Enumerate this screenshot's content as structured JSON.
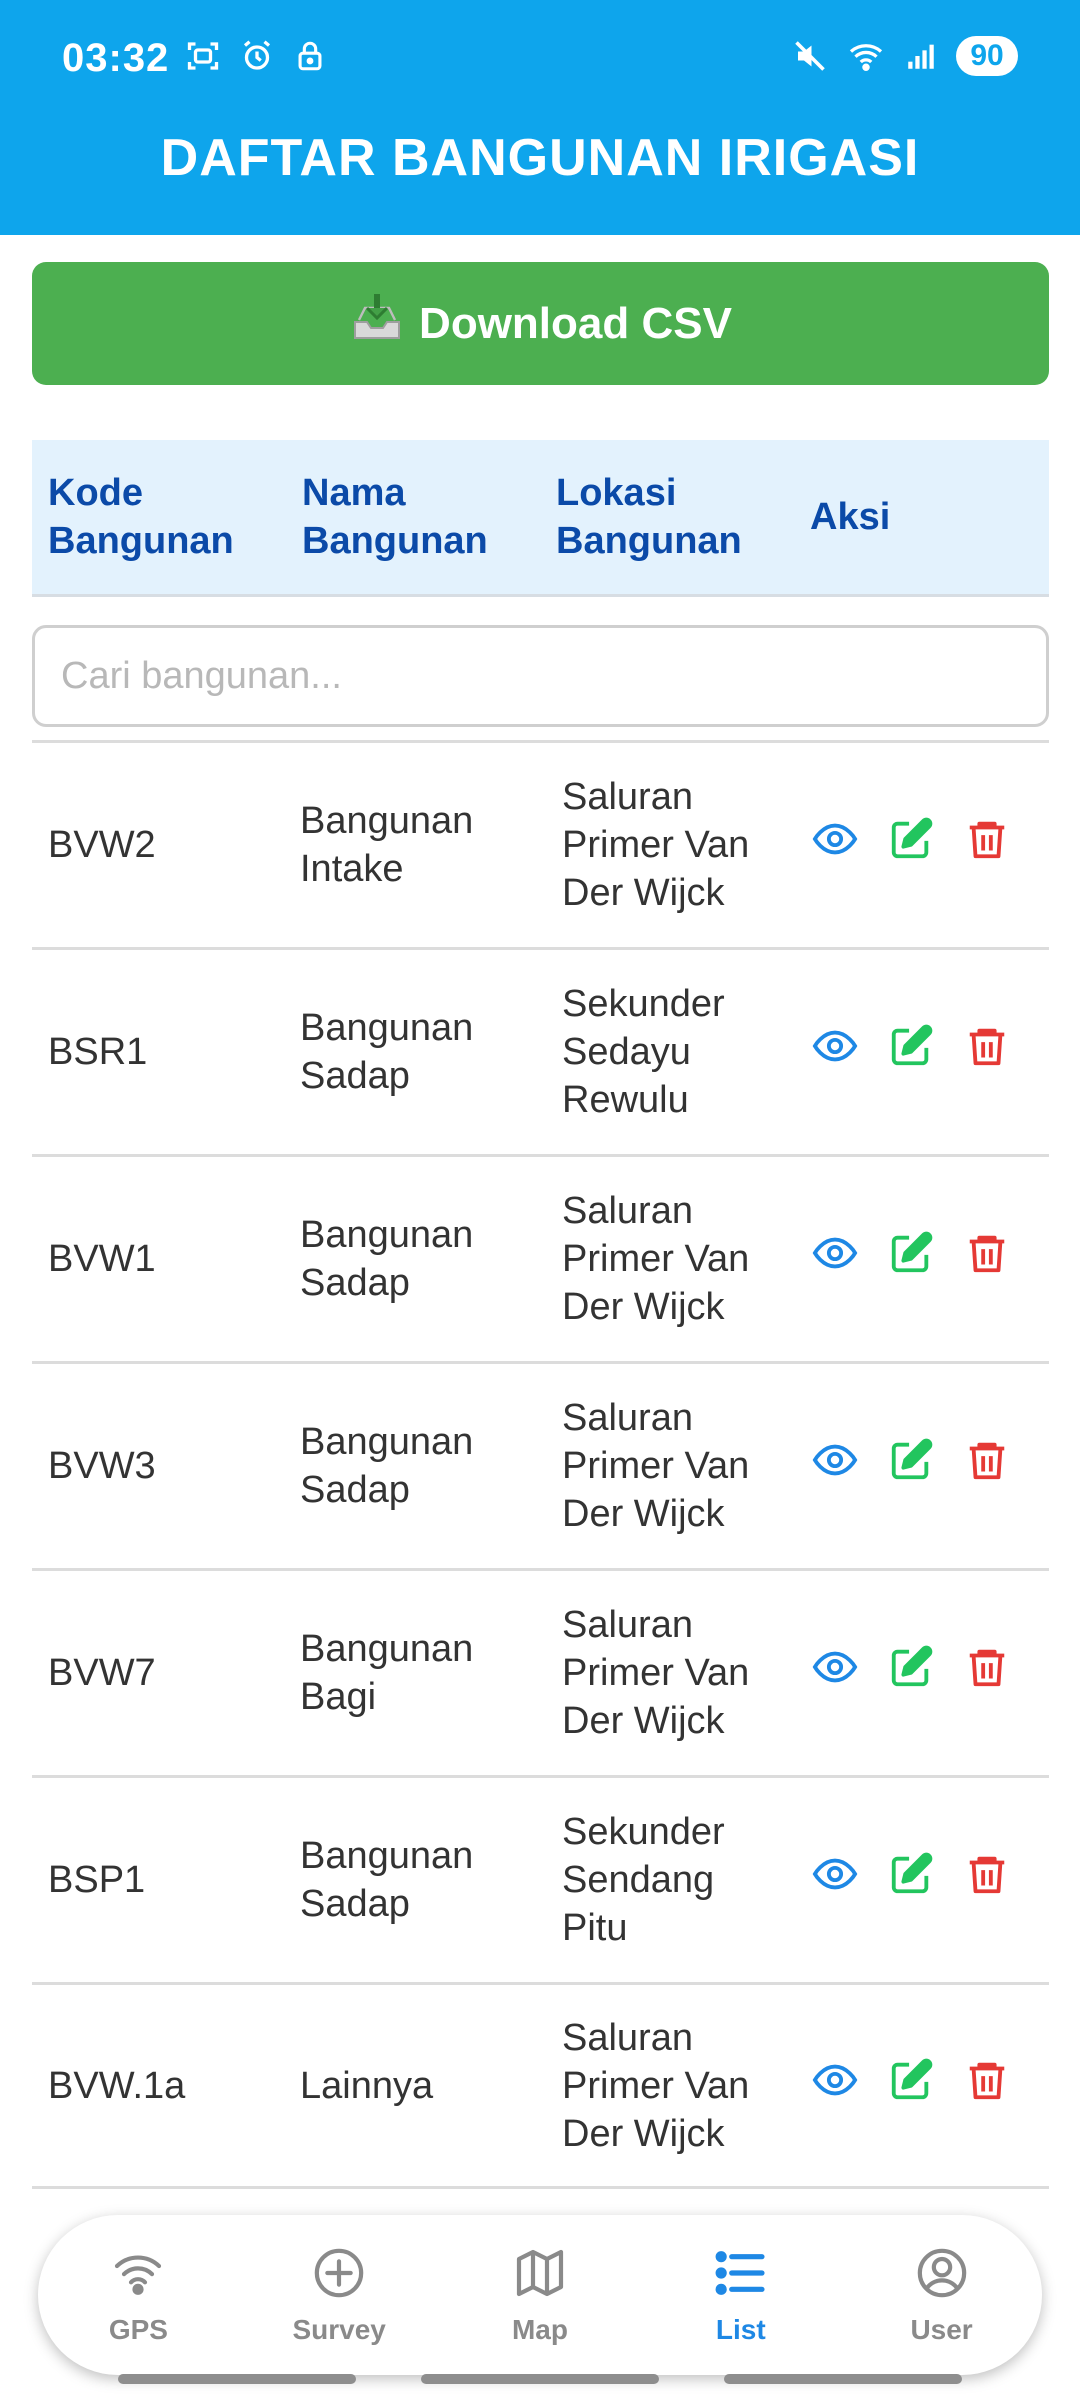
{
  "status_bar": {
    "time": "03:32",
    "battery": "90"
  },
  "header": {
    "title": "DAFTAR BANGUNAN IRIGASI"
  },
  "download_button": {
    "label": "Download CSV",
    "icon": "download-tray-icon"
  },
  "table": {
    "headers": [
      {
        "line1": "Kode",
        "line2": "Bangunan"
      },
      {
        "line1": "Nama",
        "line2": "Bangunan"
      },
      {
        "line1": "Lokasi",
        "line2": "Bangunan"
      },
      {
        "line1": "Aksi",
        "line2": ""
      }
    ],
    "rows": [
      {
        "kode": "BVW2",
        "nama": [
          "Bangunan",
          "Intake"
        ],
        "lokasi": [
          "Saluran",
          "Primer Van",
          "Der Wijck"
        ]
      },
      {
        "kode": "BSR1",
        "nama": [
          "Bangunan",
          "Sadap"
        ],
        "lokasi": [
          "Sekunder",
          "Sedayu",
          "Rewulu"
        ]
      },
      {
        "kode": "BVW1",
        "nama": [
          "Bangunan",
          "Sadap"
        ],
        "lokasi": [
          "Saluran",
          "Primer Van",
          "Der Wijck"
        ]
      },
      {
        "kode": "BVW3",
        "nama": [
          "Bangunan",
          "Sadap"
        ],
        "lokasi": [
          "Saluran",
          "Primer Van",
          "Der Wijck"
        ]
      },
      {
        "kode": "BVW7",
        "nama": [
          "Bangunan",
          "Bagi"
        ],
        "lokasi": [
          "Saluran",
          "Primer Van",
          "Der Wijck"
        ]
      },
      {
        "kode": "BSP1",
        "nama": [
          "Bangunan",
          "Sadap"
        ],
        "lokasi": [
          "Sekunder",
          "Sendang",
          "Pitu"
        ]
      },
      {
        "kode": "BVW.1a",
        "nama": [
          "Lainnya"
        ],
        "lokasi": [
          "Saluran",
          "Primer Van",
          "Der Wijck"
        ]
      }
    ]
  },
  "search": {
    "placeholder": "Cari bangunan..."
  },
  "colors": {
    "header": "#0ea5ec",
    "download": "#4caf50",
    "view": "#1e88e5",
    "edit": "#22c55e",
    "delete": "#e53935",
    "nav_active": "#1e88e5"
  },
  "nav": {
    "items": [
      {
        "label": "GPS",
        "icon": "gps-signal-icon",
        "active": false
      },
      {
        "label": "Survey",
        "icon": "plus-circle-icon",
        "active": false
      },
      {
        "label": "Map",
        "icon": "map-icon",
        "active": false
      },
      {
        "label": "List",
        "icon": "list-icon",
        "active": true
      },
      {
        "label": "User",
        "icon": "user-circle-icon",
        "active": false
      }
    ]
  }
}
